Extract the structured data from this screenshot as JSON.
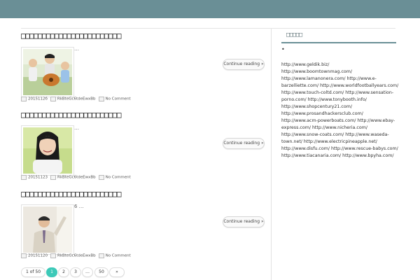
{
  "posts": [
    {
      "title": "□□□□□□□□□□□□□□□□□□□□□□□□",
      "excerpt": "…",
      "continue_label": "Continue reading »",
      "date": "2015112б",
      "author": "RkBteGc6tdeEwxBb",
      "comments": "No Comment",
      "image": "children-with-guitar-photo"
    },
    {
      "title": "□□□□□□□□□□□□□□□□□□□□□□□□",
      "excerpt": "…",
      "continue_label": "Continue reading »",
      "date": "20151123",
      "author": "RkBteGc6tdeEwxBb",
      "comments": "No Comment",
      "image": "smiling-girl-photo"
    },
    {
      "title": "□□□□□□□□□□□□□□□□□□□□□□□□",
      "excerpt": "6 …",
      "continue_label": "Continue reading »",
      "date": "20151120",
      "author": "RkBteGc6tdeEwxBb",
      "comments": "No Comment",
      "image": "man-in-suit-photo"
    }
  ],
  "pagination": {
    "summary": "1 of 50",
    "current": "1",
    "pages": [
      "2",
      "3"
    ],
    "ellipsis": "…",
    "last": "50",
    "next": "»"
  },
  "sidebar": {
    "widget_title": "□□□□□",
    "bullet": "•",
    "links_text": "http://www.geldik.biz/ http://www.boomtownmag.com/ http://www.lamanonera.com/ http://www.e-barzelliette.com/ http://www.worldfootballyears.com/ http://www.touch-coltd.com/ http://www.sensation-porno.com/ http://www.tonybooth.info/ http://www.shopcentury21.com/ http://www.prosandhackersclub.com/ http://www.acm-powerboats.com/ http://www.ebay-express.com/ http://www.nicheria.com/ http://www.snow-coats.com/ http://www.waseda-town.net/ http://www.electricpineapple.net/ http://www.disfu.com/ http://www.rescue-babys.com/ http://www.tiacanaria.com/ http://www.bpyha.com/"
  },
  "colors": {
    "header_bar": "#6a8f96",
    "pager_active": "#3dc9b8"
  }
}
